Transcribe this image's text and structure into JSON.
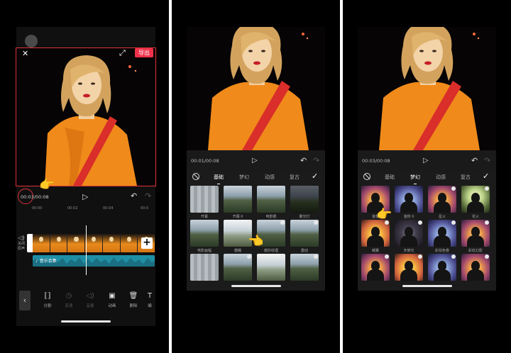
{
  "panel1": {
    "close_icon": "✕",
    "fullscreen_icon": "⤢",
    "export_label": "导出",
    "timecode": "00:03/00:08",
    "play_icon": "▷",
    "undo_icon": "↶",
    "redo_icon": "↷",
    "ruler": [
      "00:00",
      "00:02",
      "00:04",
      "00:0"
    ],
    "audio_label": "关闭原声",
    "add_icon": "+",
    "music_label": "♪ 音乐合集",
    "back_icon": "‹",
    "tools": [
      {
        "icon": "⟦⟧",
        "label": "分割",
        "dim": false
      },
      {
        "icon": "◷",
        "label": "变速",
        "dim": true
      },
      {
        "icon": "◁)",
        "label": "音量",
        "dim": true
      },
      {
        "icon": "▣",
        "label": "动画",
        "dim": false
      },
      {
        "icon": "🗑",
        "label": "删除",
        "dim": false
      },
      {
        "icon": "T",
        "label": "编",
        "dim": false
      }
    ]
  },
  "panel2": {
    "timecode": "00:01/00:08",
    "tabs": [
      "基础",
      "梦幻",
      "动感",
      "复古"
    ],
    "active_tab": 0,
    "effects": [
      {
        "label": "开幕",
        "thumb": "land pixel",
        "dl": false
      },
      {
        "label": "开幕 II",
        "thumb": "land",
        "dl": false
      },
      {
        "label": "电影眼",
        "thumb": "land",
        "dl": false
      },
      {
        "label": "聚光灯",
        "thumb": "land dark",
        "dl": false
      },
      {
        "label": "电影画幅",
        "thumb": "land",
        "dl": false
      },
      {
        "label": "模糊",
        "thumb": "land bright",
        "dl": true
      },
      {
        "label": "磨砂纹理",
        "thumb": "land",
        "dl": true
      },
      {
        "label": "震动",
        "thumb": "land",
        "dl": true
      },
      {
        "label": "",
        "thumb": "land pixel",
        "dl": false
      },
      {
        "label": "",
        "thumb": "land",
        "dl": true
      },
      {
        "label": "",
        "thumb": "land bright",
        "dl": true
      },
      {
        "label": "",
        "thumb": "land",
        "dl": true
      }
    ]
  },
  "panel3": {
    "timecode": "00:03/00:08",
    "tabs": [
      "基础",
      "梦幻",
      "动感",
      "复古"
    ],
    "active_tab": 1,
    "effects": [
      {
        "label": "金粉",
        "thumb": "sun",
        "dl": false
      },
      {
        "label": "金粉 II",
        "thumb": "sun cool",
        "dl": false
      },
      {
        "label": "星火",
        "thumb": "sun",
        "dl": true
      },
      {
        "label": "花火",
        "thumb": "sun green",
        "dl": true
      },
      {
        "label": "蝶翼",
        "thumb": "sun warm",
        "dl": true
      },
      {
        "label": "天使光",
        "thumb": "sun night",
        "dl": true
      },
      {
        "label": "彩炫色卷",
        "thumb": "sun cool",
        "dl": true
      },
      {
        "label": "彩虹幻影",
        "thumb": "sun",
        "dl": true
      },
      {
        "label": "",
        "thumb": "sun",
        "dl": true
      },
      {
        "label": "",
        "thumb": "sun warm",
        "dl": true
      },
      {
        "label": "",
        "thumb": "sun cool",
        "dl": true
      },
      {
        "label": "",
        "thumb": "sun",
        "dl": true
      }
    ]
  },
  "colors": {
    "accent_red": "#f0304a",
    "music_track": "#1f8fa5",
    "shirt_orange": "#f08a1a",
    "strap_red": "#d92e2a"
  }
}
